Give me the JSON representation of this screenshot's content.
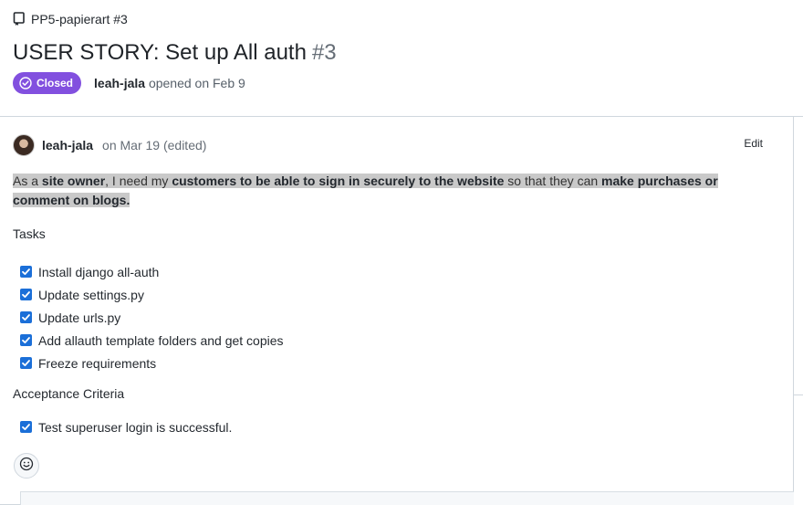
{
  "repo": {
    "name": "PP5-papierart #3",
    "icon": "repo-icon"
  },
  "issue": {
    "title": "USER STORY: Set up All auth",
    "number": "#3",
    "status": "Closed",
    "status_icon": "check-circle-icon",
    "status_color": "#8250df",
    "author": "leah-jala",
    "opened_text": "opened on Feb 9"
  },
  "comment": {
    "author": "leah-jala",
    "date": "on Mar 19 (edited)",
    "edit_label": "Edit",
    "story": {
      "p1": "As a ",
      "b1": "site owner",
      "p2": ", I need my ",
      "b2": "customers to be able to sign in securely to the website",
      "p3": " so that they can ",
      "b3": "make purchases or comment on blogs",
      "p4": "."
    },
    "tasks_heading": "Tasks",
    "tasks": [
      {
        "label": "Install django all-auth",
        "checked": true
      },
      {
        "label": "Update settings.py",
        "checked": true
      },
      {
        "label": "Update urls.py",
        "checked": true
      },
      {
        "label": "Add allauth template folders and get copies",
        "checked": true
      },
      {
        "label": "Freeze requirements",
        "checked": true
      }
    ],
    "acceptance_heading": "Acceptance Criteria",
    "acceptance": [
      {
        "label": "Test superuser login is successful.",
        "checked": true
      }
    ],
    "reaction_icon": "smiley-icon"
  }
}
